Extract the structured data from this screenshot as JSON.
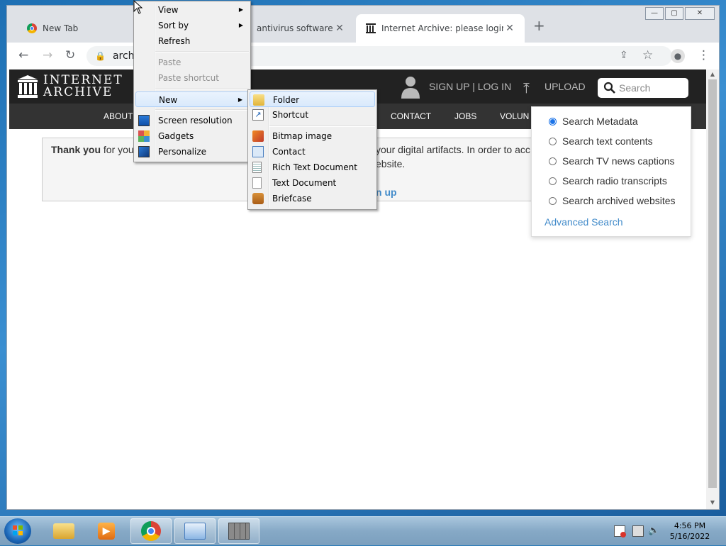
{
  "browser": {
    "tabs": [
      {
        "title": "New Tab"
      },
      {
        "title": "antivirus software pro"
      },
      {
        "title": "Internet Archive: please login or p"
      }
    ],
    "address_text": "archi",
    "window_controls": {
      "minimize": "—",
      "maximize": "▢",
      "close": "✕"
    }
  },
  "ia": {
    "logo_line1": "INTERNET",
    "logo_line2": "ARCHIVE",
    "signup_login": "SIGN UP | LOG IN",
    "upload": "UPLOAD",
    "search_placeholder": "Search",
    "nav": [
      "ABOUT",
      "CONTACT",
      "JOBS",
      "VOLUN"
    ]
  },
  "notice": {
    "bold": "Thank you",
    "rest": " for you",
    "right_line1": "your digital artifacts. In order to acc",
    "right_line2": "ebsite.",
    "link_fragment": "n up"
  },
  "search_dropdown": {
    "options": [
      {
        "label": "Search Metadata",
        "selected": true
      },
      {
        "label": "Search text contents",
        "selected": false
      },
      {
        "label": "Search TV news captions",
        "selected": false
      },
      {
        "label": "Search radio transcripts",
        "selected": false
      },
      {
        "label": "Search archived websites",
        "selected": false
      }
    ],
    "advanced": "Advanced Search"
  },
  "context_menu": {
    "view": "View",
    "sort_by": "Sort by",
    "refresh": "Refresh",
    "paste": "Paste",
    "paste_shortcut": "Paste shortcut",
    "new": "New",
    "screen_resolution": "Screen resolution",
    "gadgets": "Gadgets",
    "personalize": "Personalize"
  },
  "new_submenu": {
    "folder": "Folder",
    "shortcut": "Shortcut",
    "bitmap": "Bitmap image",
    "contact": "Contact",
    "rtf": "Rich Text Document",
    "text": "Text Document",
    "briefcase": "Briefcase"
  },
  "taskbar": {
    "time": "4:56 PM",
    "date": "5/16/2022"
  },
  "colors": {
    "ia_header": "#222222",
    "ia_nav": "#333333",
    "link_blue": "#428bca",
    "menu_bg": "#f0f0f0"
  }
}
